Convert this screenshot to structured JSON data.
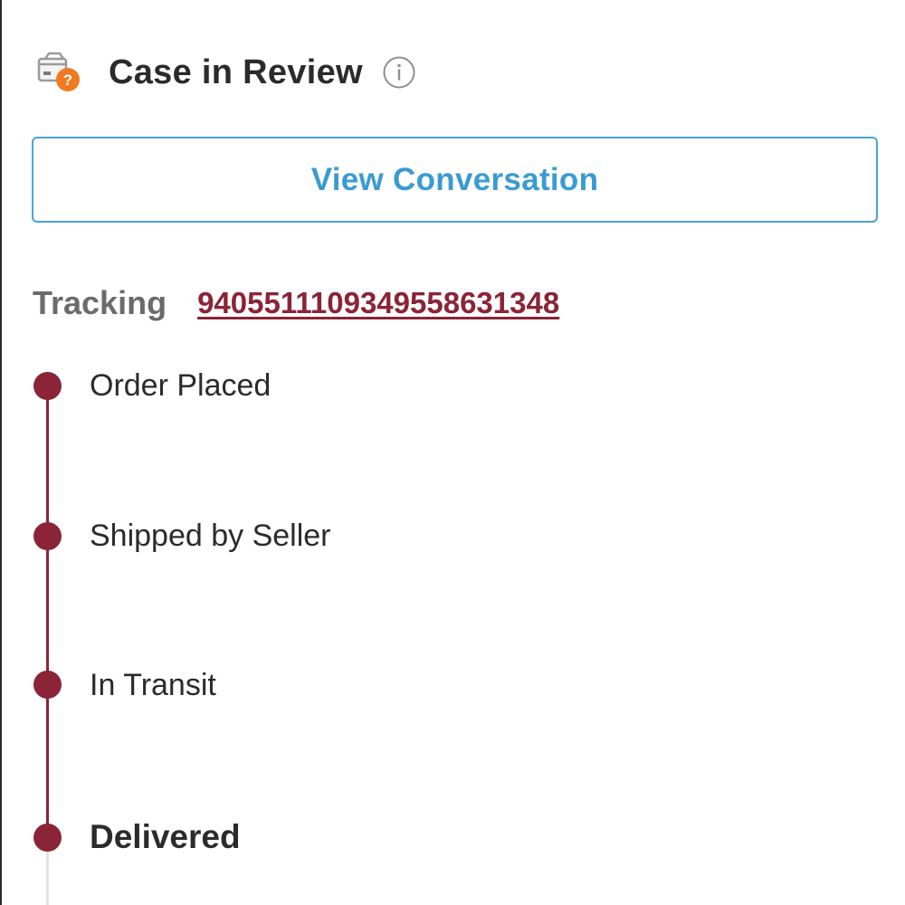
{
  "header": {
    "title": "Case in Review",
    "status_icon": "package-question-icon",
    "info_icon": "info-icon"
  },
  "actions": {
    "view_conversation_label": "View Conversation"
  },
  "tracking": {
    "label": "Tracking",
    "number": "9405511109349558631348"
  },
  "timeline": {
    "steps": [
      {
        "label": "Order Placed",
        "completed": true,
        "current": false
      },
      {
        "label": "Shipped by Seller",
        "completed": true,
        "current": false
      },
      {
        "label": "In Transit",
        "completed": true,
        "current": false
      },
      {
        "label": "Delivered",
        "completed": true,
        "current": true
      }
    ]
  },
  "colors": {
    "accent_blue": "#3a9bd3",
    "timeline_maroon": "#8a2436",
    "badge_orange": "#f07a22",
    "text_dark": "#2b2b2b",
    "text_gray": "#6b6b6b"
  }
}
